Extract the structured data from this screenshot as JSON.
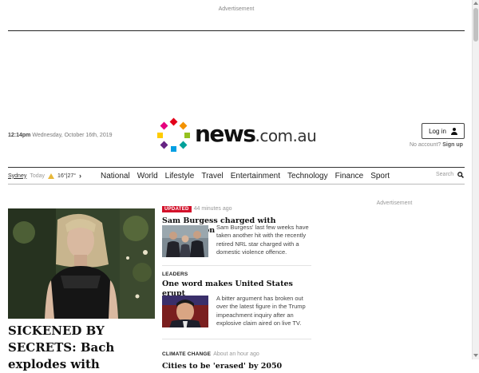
{
  "advertisement_top": "Advertisement",
  "dateline": {
    "time": "12:14pm",
    "date": "Wednesday, October 16th, 2019"
  },
  "logo": {
    "name": "news",
    "suffix": ".com.au"
  },
  "account": {
    "login_label": "Log in",
    "prompt": "No account?",
    "signup_label": "Sign up"
  },
  "weather": {
    "city": "Sydney",
    "day": "Today",
    "temps": "16°|27°",
    "icon": "sun-cloud-icon"
  },
  "nav": {
    "links": [
      "National",
      "World",
      "Lifestyle",
      "Travel",
      "Entertainment",
      "Technology",
      "Finance",
      "Sport"
    ],
    "search_label": "Search"
  },
  "hero": {
    "title": "SICKENED BY SECRETS: Bach explodes with"
  },
  "stories": [
    {
      "badge": "UPDATED",
      "meta": "44 minutes ago",
      "headline": "Sam Burgess charged with intimidation",
      "summary": "Sam Burgess' last few weeks have taken another hit with the recently retired NRL star charged with a domestic violence offence."
    },
    {
      "kicker": "LEADERS",
      "headline": "One word makes United States erupt",
      "summary": "A bitter argument has broken out over the latest figure in the Trump impeachment inquiry after an explosive claim aired on live TV."
    },
    {
      "kicker": "CLIMATE CHANGE",
      "meta": "About an hour ago",
      "headline": "Cities to be 'erased' by 2050"
    }
  ],
  "advertisement_right": "Advertisement",
  "colors": {
    "accent": "#d3112a",
    "text": "#111111",
    "muted": "#999999",
    "logo_dots": [
      "#e2001a",
      "#f39200",
      "#95c11f",
      "#009fe3",
      "#662483",
      "#e6007e",
      "#ffcc00",
      "#00a19a"
    ]
  }
}
